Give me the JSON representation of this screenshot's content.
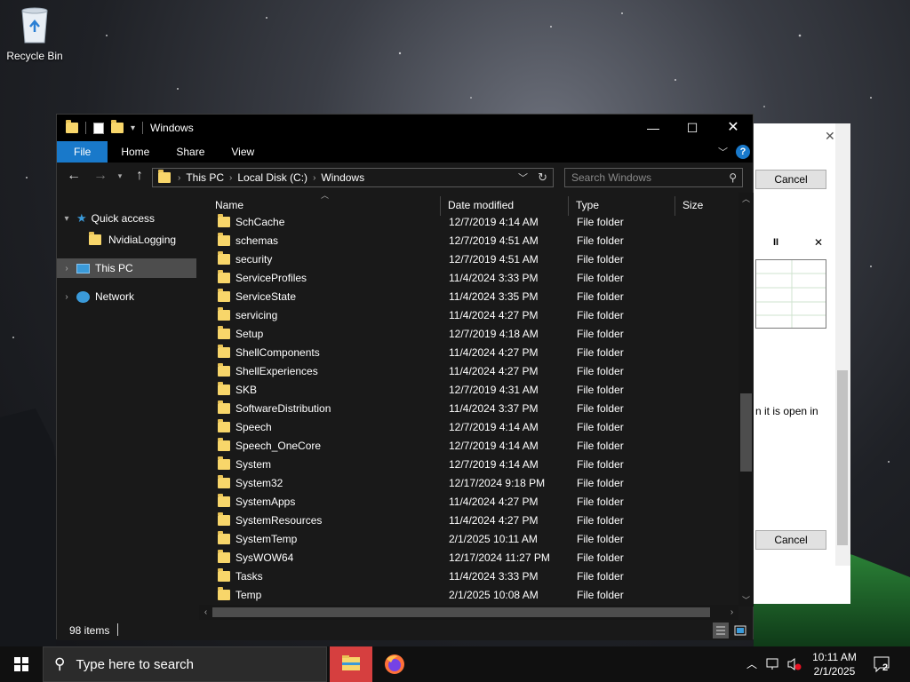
{
  "desktop": {
    "recycle_bin_label": "Recycle Bin"
  },
  "background_dialog": {
    "cancel_top": "Cancel",
    "cancel_bottom": "Cancel",
    "partial_text": "n it is open in",
    "pause": "II",
    "close": "✕"
  },
  "window": {
    "title": "Windows",
    "controls": {
      "minimize": "—",
      "maximize": "☐",
      "close": "✕"
    },
    "ribbon_tabs": [
      "File",
      "Home",
      "Share",
      "View"
    ],
    "help": "?",
    "address": {
      "segments": [
        "This PC",
        "Local Disk (C:)",
        "Windows"
      ]
    },
    "search_placeholder": "Search Windows",
    "nav": {
      "quick_access": "Quick access",
      "nvidia": "NvidiaLogging",
      "this_pc": "This PC",
      "network": "Network"
    },
    "columns": {
      "name": "Name",
      "date": "Date modified",
      "type": "Type",
      "size": "Size"
    },
    "rows": [
      {
        "name": "SchCache",
        "date": "12/7/2019 4:14 AM",
        "type": "File folder"
      },
      {
        "name": "schemas",
        "date": "12/7/2019 4:51 AM",
        "type": "File folder"
      },
      {
        "name": "security",
        "date": "12/7/2019 4:51 AM",
        "type": "File folder"
      },
      {
        "name": "ServiceProfiles",
        "date": "11/4/2024 3:33 PM",
        "type": "File folder"
      },
      {
        "name": "ServiceState",
        "date": "11/4/2024 3:35 PM",
        "type": "File folder"
      },
      {
        "name": "servicing",
        "date": "11/4/2024 4:27 PM",
        "type": "File folder"
      },
      {
        "name": "Setup",
        "date": "12/7/2019 4:18 AM",
        "type": "File folder"
      },
      {
        "name": "ShellComponents",
        "date": "11/4/2024 4:27 PM",
        "type": "File folder"
      },
      {
        "name": "ShellExperiences",
        "date": "11/4/2024 4:27 PM",
        "type": "File folder"
      },
      {
        "name": "SKB",
        "date": "12/7/2019 4:31 AM",
        "type": "File folder"
      },
      {
        "name": "SoftwareDistribution",
        "date": "11/4/2024 3:37 PM",
        "type": "File folder"
      },
      {
        "name": "Speech",
        "date": "12/7/2019 4:14 AM",
        "type": "File folder"
      },
      {
        "name": "Speech_OneCore",
        "date": "12/7/2019 4:14 AM",
        "type": "File folder"
      },
      {
        "name": "System",
        "date": "12/7/2019 4:14 AM",
        "type": "File folder"
      },
      {
        "name": "System32",
        "date": "12/17/2024 9:18 PM",
        "type": "File folder"
      },
      {
        "name": "SystemApps",
        "date": "11/4/2024 4:27 PM",
        "type": "File folder"
      },
      {
        "name": "SystemResources",
        "date": "11/4/2024 4:27 PM",
        "type": "File folder"
      },
      {
        "name": "SystemTemp",
        "date": "2/1/2025 10:11 AM",
        "type": "File folder"
      },
      {
        "name": "SysWOW64",
        "date": "12/17/2024 11:27 PM",
        "type": "File folder"
      },
      {
        "name": "Tasks",
        "date": "11/4/2024 3:33 PM",
        "type": "File folder"
      },
      {
        "name": "Temp",
        "date": "2/1/2025 10:08 AM",
        "type": "File folder"
      }
    ],
    "status": {
      "item_count": "98 items"
    }
  },
  "taskbar": {
    "search_placeholder": "Type here to search",
    "time": "10:11 AM",
    "date": "2/1/2025",
    "notification_count": "2"
  },
  "colors": {
    "accent": "#1979ca",
    "folder": "#f8d66a",
    "taskbar_active": "#d63f3f"
  }
}
